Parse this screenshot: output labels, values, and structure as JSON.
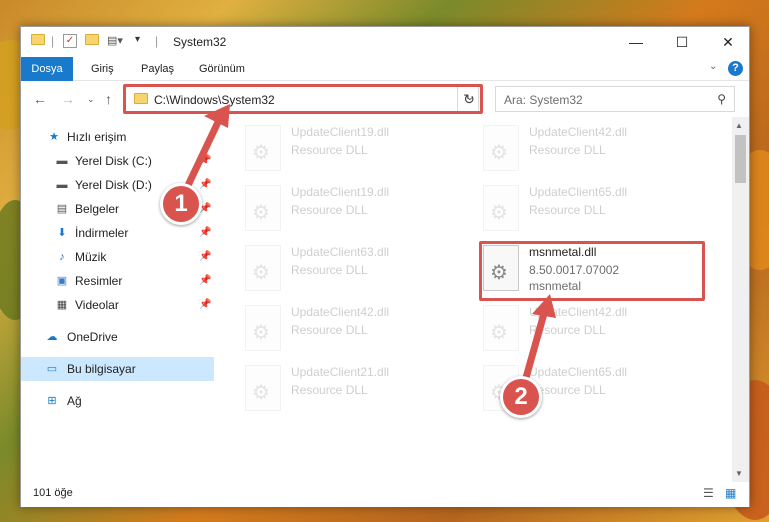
{
  "window": {
    "title": "System32",
    "controls": {
      "minimize": "—",
      "maximize": "☐",
      "close": "✕"
    }
  },
  "ribbon": {
    "tabs": [
      "Dosya",
      "Giriş",
      "Paylaş",
      "Görünüm"
    ],
    "help": "?"
  },
  "navigation": {
    "address_path": "C:\\Windows\\System32",
    "search_placeholder": "Ara: System32"
  },
  "sidebar": {
    "items": [
      {
        "label": "Hızlı erişim",
        "icon": "star-icon"
      },
      {
        "label": "Yerel Disk (C:)",
        "icon": "drive-icon"
      },
      {
        "label": "Yerel Disk (D:)",
        "icon": "drive-icon"
      },
      {
        "label": "Belgeler",
        "icon": "documents-icon"
      },
      {
        "label": "İndirmeler",
        "icon": "download-icon"
      },
      {
        "label": "Müzik",
        "icon": "music-icon"
      },
      {
        "label": "Resimler",
        "icon": "pictures-icon"
      },
      {
        "label": "Videolar",
        "icon": "videos-icon"
      },
      {
        "label": "OneDrive",
        "icon": "cloud-icon"
      },
      {
        "label": "Bu bilgisayar",
        "icon": "computer-icon"
      },
      {
        "label": "Ağ",
        "icon": "network-icon"
      }
    ]
  },
  "files": [
    {
      "name": "UpdateClient19.dll",
      "desc": "Resource DLL"
    },
    {
      "name": "UpdateClient42.dll",
      "desc": "Resource DLL"
    },
    {
      "name": "UpdateClient19.dll",
      "desc": "Resource DLL"
    },
    {
      "name": "UpdateClient65.dll",
      "desc": "Resource DLL"
    },
    {
      "name": "UpdateClient63.dll",
      "desc": "Resource DLL"
    },
    {
      "name": "msnmetal.dll",
      "desc": "8.50.0017.07002",
      "desc2": "msnmetal"
    },
    {
      "name": "UpdateClient42.dll",
      "desc": "Resource DLL"
    },
    {
      "name": "UpdateClient42.dll",
      "desc": "Resource DLL"
    },
    {
      "name": "UpdateClient21.dll",
      "desc": "Resource DLL"
    },
    {
      "name": "UpdateClient65.dll",
      "desc": "Resource DLL"
    }
  ],
  "status": {
    "item_count": "101 öğe"
  },
  "annotations": {
    "badge1": "1",
    "badge2": "2",
    "accent": "#d9534f"
  }
}
